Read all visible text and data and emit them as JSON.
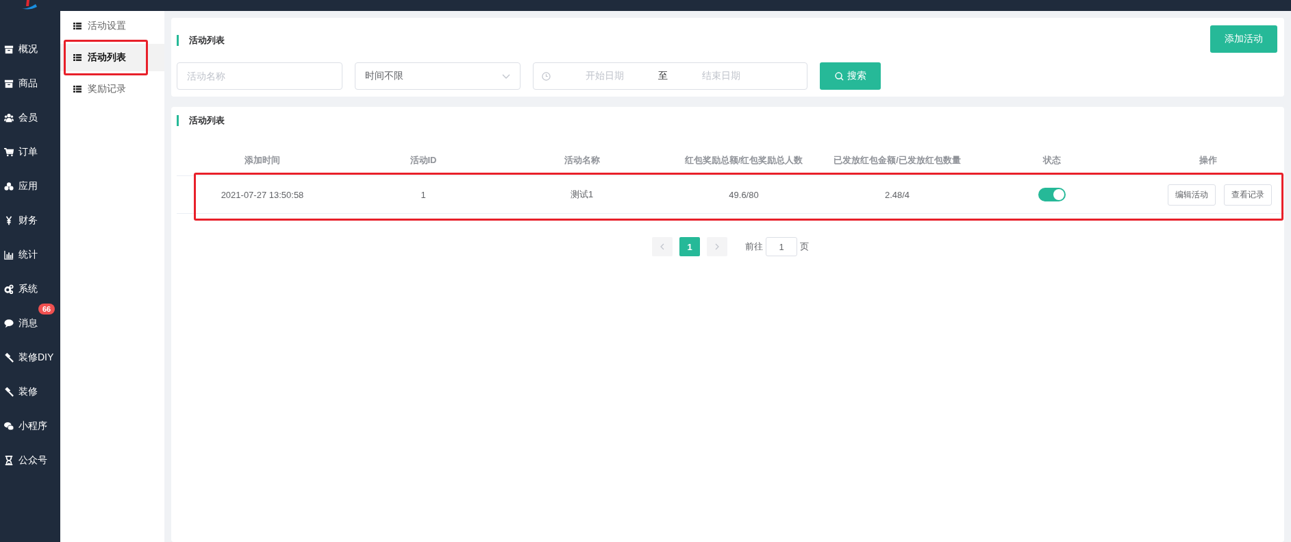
{
  "sidebar": {
    "items": [
      {
        "label": "概况"
      },
      {
        "label": "商品"
      },
      {
        "label": "会员"
      },
      {
        "label": "订单"
      },
      {
        "label": "应用"
      },
      {
        "label": "财务"
      },
      {
        "label": "统计"
      },
      {
        "label": "系统"
      },
      {
        "label": "消息",
        "badge": "66"
      },
      {
        "label": "装修DIY"
      },
      {
        "label": "装修"
      },
      {
        "label": "小程序"
      },
      {
        "label": "公众号"
      }
    ]
  },
  "submenu": {
    "items": [
      {
        "label": "活动设置",
        "selected": false
      },
      {
        "label": "活动列表",
        "selected": true
      },
      {
        "label": "奖励记录",
        "selected": false
      }
    ]
  },
  "filter_card": {
    "title": "活动列表",
    "add_button": "添加活动",
    "name_field": {
      "placeholder": "活动名称"
    },
    "time_select": {
      "value": "时间不限"
    },
    "date_range": {
      "start_placeholder": "开始日期",
      "separator": "至",
      "end_placeholder": "结束日期"
    },
    "search_button": "搜索"
  },
  "table_card": {
    "title": "活动列表",
    "table": {
      "columns": [
        "添加时间",
        "活动ID",
        "活动名称",
        "红包奖励总额/红包奖励总人数",
        "已发放红包金额/已发放红包数量",
        "状态",
        "操作"
      ],
      "rows": [
        {
          "added": "2021-07-27 13:50:58",
          "id": "1",
          "name": "测试1",
          "reward": "49.6/80",
          "issued": "2.48/4",
          "on": true,
          "actions": [
            "编辑活动",
            "查看记录"
          ]
        }
      ]
    },
    "pagination": {
      "pages": [
        {
          "label": "1",
          "selected": true
        }
      ],
      "goto_label": "前往",
      "goto_value": "1",
      "page_label": "页"
    }
  }
}
